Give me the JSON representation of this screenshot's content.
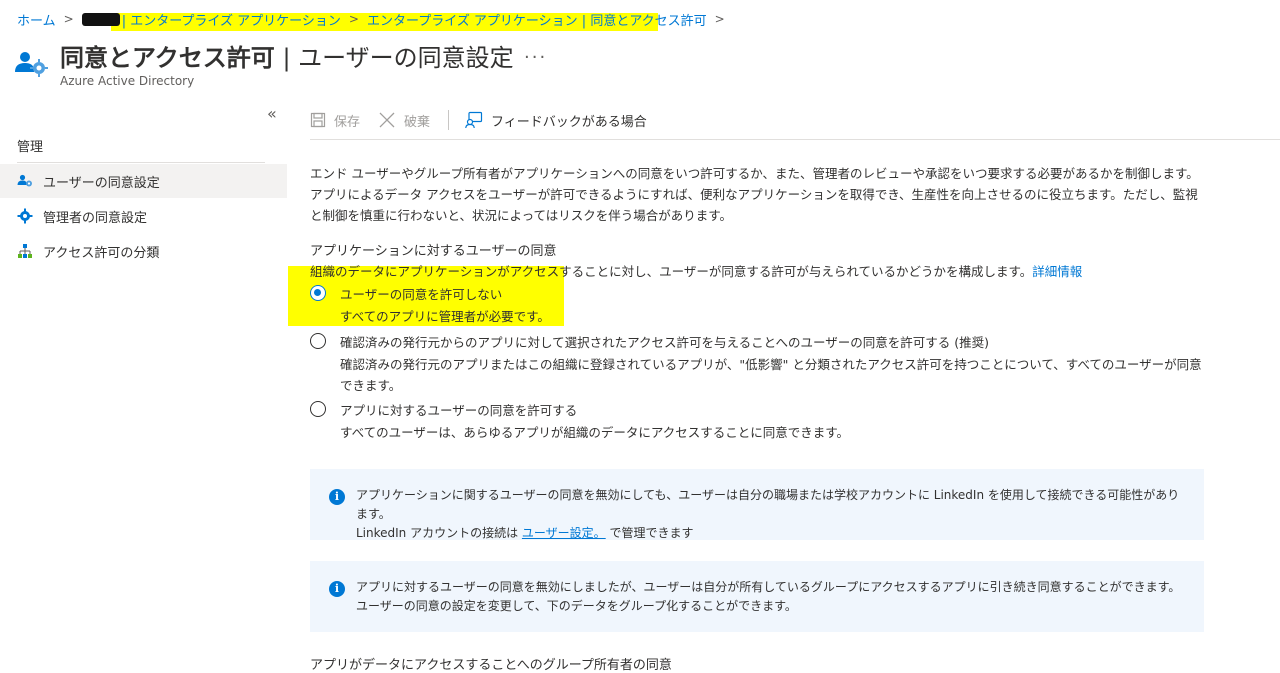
{
  "breadcrumb": {
    "items": [
      "ホーム",
      "| エンタープライズ アプリケーション",
      "エンタープライズ アプリケーション | 同意とアクセス許可"
    ]
  },
  "header": {
    "title_bold": "同意とアクセス許可",
    "title_rest": " | ユーザーの同意設定",
    "more": "...",
    "subtitle": "Azure Active Directory"
  },
  "sidebar": {
    "collapse": "«",
    "heading": "管理",
    "items": [
      {
        "label": "ユーザーの同意設定",
        "icon": "user-settings-icon"
      },
      {
        "label": "管理者の同意設定",
        "icon": "gear-icon"
      },
      {
        "label": "アクセス許可の分類",
        "icon": "hierarchy-icon"
      }
    ]
  },
  "toolbar": {
    "save_label": "保存",
    "discard_label": "破棄",
    "feedback_label": "フィードバックがある場合"
  },
  "main": {
    "description": "エンド ユーザーやグループ所有者がアプリケーションへの同意をいつ許可するか、また、管理者のレビューや承認をいつ要求する必要があるかを制御します。アプリによるデータ アクセスをユーザーが許可できるようにすれば、便利なアプリケーションを取得でき、生産性を向上させるのに役立ちます。ただし、監視と制御を慎重に行わないと、状況によってはリスクを伴う場合があります。",
    "section_heading": "アプリケーションに対するユーザーの同意",
    "section_desc": "組織のデータにアプリケーションがアクセスすることに対し、ユーザーが同意する許可が与えられているかどうかを構成します。",
    "section_link": "詳細情報",
    "options": [
      {
        "label": "ユーザーの同意を許可しない",
        "sub": "すべてのアプリに管理者が必要です。",
        "checked": true
      },
      {
        "label": "確認済みの発行元からのアプリに対して選択されたアクセス許可を与えることへのユーザーの同意を許可する (推奨)",
        "sub": "確認済みの発行元のアプリまたはこの組織に登録されているアプリが、\"低影響\" と分類されたアクセス許可を持つことについて、すべてのユーザーが同意できます。",
        "checked": false
      },
      {
        "label": "アプリに対するユーザーの同意を許可する",
        "sub": "すべてのユーザーは、あらゆるアプリが組織のデータにアクセスすることに同意できます。",
        "checked": false
      }
    ],
    "info1_line1": "アプリケーションに関するユーザーの同意を無効にしても、ユーザーは自分の職場または学校アカウントに LinkedIn を使用して接続できる可能性があります。",
    "info1_line2_pre": "LinkedIn アカウントの接続は ",
    "info1_link": "ユーザー設定。",
    "info1_line2_post": " で管理できます",
    "info2_text": "アプリに対するユーザーの同意を無効にしましたが、ユーザーは自分が所有しているグループにアクセスするアプリに引き続き同意することができます。ユーザーの同意の設定を変更して、下のデータをグループ化することができます。",
    "bottom_heading": "アプリがデータにアクセスすることへのグループ所有者の同意"
  },
  "colors": {
    "accent": "#0078d4",
    "highlight": "#ffff00",
    "info_bg": "#f0f6fd"
  }
}
